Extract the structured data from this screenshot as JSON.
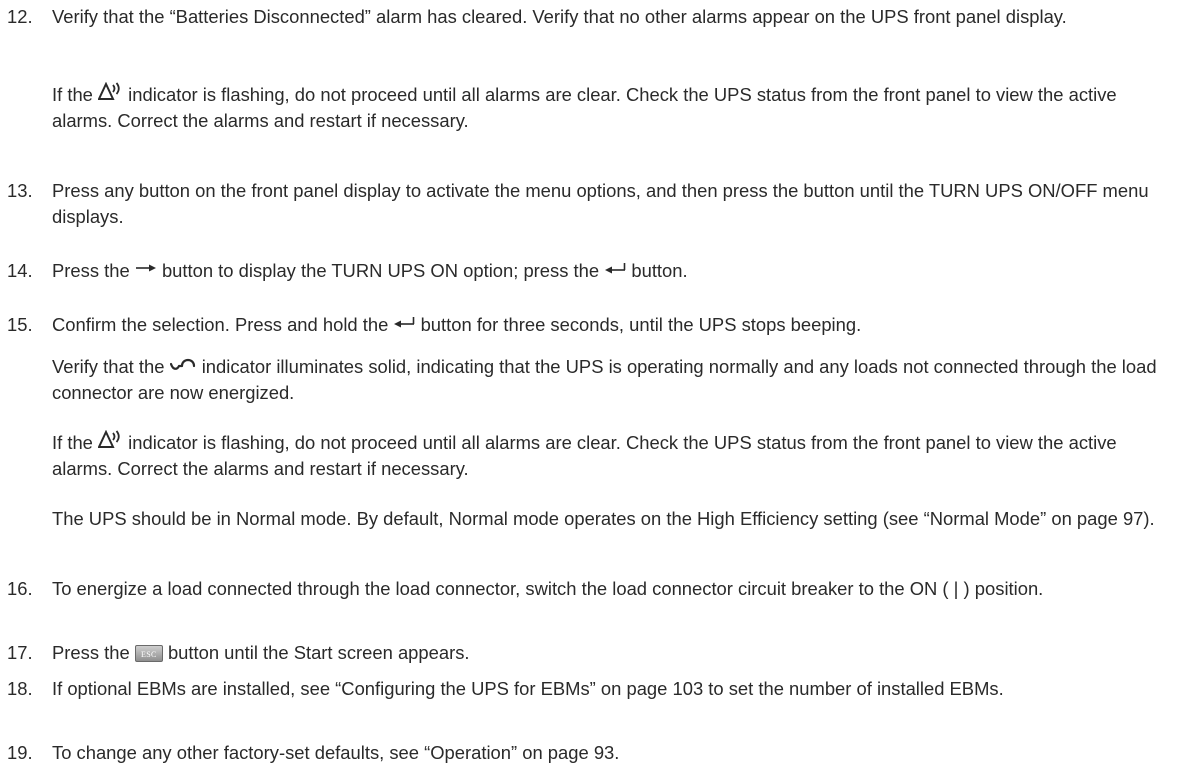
{
  "steps": [
    {
      "number": "12.",
      "text": "Verify that the “Batteries Disconnected” alarm has cleared. Verify that no other alarms appear on the UPS front panel display.",
      "note": {
        "before": "If the",
        "icon": "alarm-indicator-icon",
        "after": "indicator is flashing, do not proceed until all alarms are clear. Check the UPS status from the front panel to view the active alarms. Correct the alarms and restart if necessary."
      }
    },
    {
      "number": "13.",
      "text": "Press any button on the front panel display to activate the menu options, and then press the  button until the TURN UPS ON/OFF menu displays."
    },
    {
      "number": "14.",
      "part1": "Press the",
      "icon1": "right-arrow-icon",
      "part2": "button to display the TURN UPS ON option; press the",
      "icon2": "enter-icon",
      "part3": "button."
    },
    {
      "number": "15.",
      "part1": "Confirm the selection. Press and hold the",
      "icon1": "enter-icon",
      "part2": "button for three seconds, until the UPS stops beeping.",
      "note1": {
        "before": "Verify that the",
        "icon": "normal-indicator-icon",
        "after": "indicator illuminates solid, indicating that the UPS is operating normally and any loads not connected through the load connector are now energized."
      },
      "note2": {
        "before": "If the",
        "icon": "alarm-indicator-icon",
        "after": "indicator is flashing, do not proceed until all alarms are clear. Check the UPS status from the front panel to view the active alarms. Correct the alarms and restart if necessary."
      },
      "note3": "The UPS should be in Normal mode. By default, Normal mode operates on the High Efficiency setting (see “Normal Mode” on page 97)."
    },
    {
      "number": "16.",
      "text": "To energize a load connected through the load connector, switch the load connector circuit breaker to the ON ( | ) position."
    },
    {
      "number": "17.",
      "part1": "Press the",
      "key_label": "ESC",
      "part2": "button until the Start screen appears."
    },
    {
      "number": "18.",
      "text": "If optional EBMs are installed, see “Configuring the UPS for EBMs” on page 103 to set the number of installed EBMs."
    },
    {
      "number": "19.",
      "text": "To change any other factory-set defaults, see “Operation” on page 93."
    }
  ]
}
